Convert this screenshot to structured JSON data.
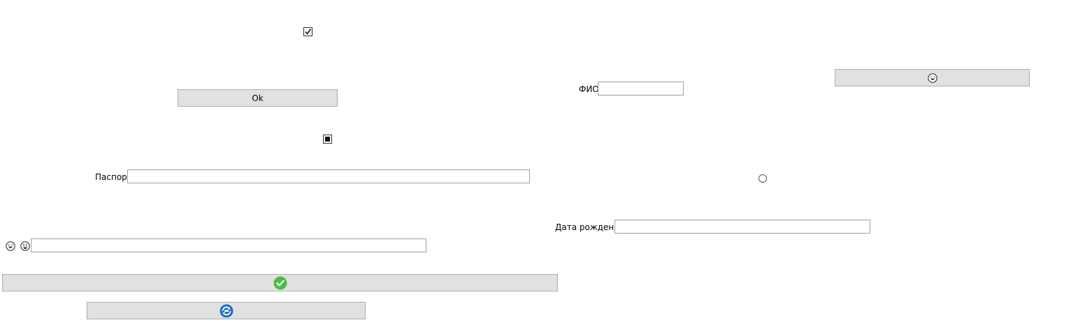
{
  "controls": {
    "ok_button_label": "Ok",
    "passport_label": "Паспорт",
    "passport_value": "",
    "fio_label": "ФИО",
    "fio_value": "",
    "birth_date_label": "Дата рождения",
    "birth_date_value": "",
    "emoji_field_value": "",
    "top_checkbox_checked": true,
    "indeterminate_checkbox": "indeterminate",
    "radio_checked": false
  },
  "icons": {
    "emoji_button_icon": "laughing-emoji-icon",
    "emoji_label_1": "laughing-emoji-icon",
    "emoji_label_2": "grinning-emoji-icon",
    "confirm_button_icon": "green-check-circle-icon",
    "refresh_button_icon": "blue-refresh-icon"
  },
  "colors": {
    "button_bg": "#e1e1e1",
    "button_border": "#adadad",
    "confirm_green": "#4cbb47",
    "refresh_blue": "#1f6fc4"
  }
}
